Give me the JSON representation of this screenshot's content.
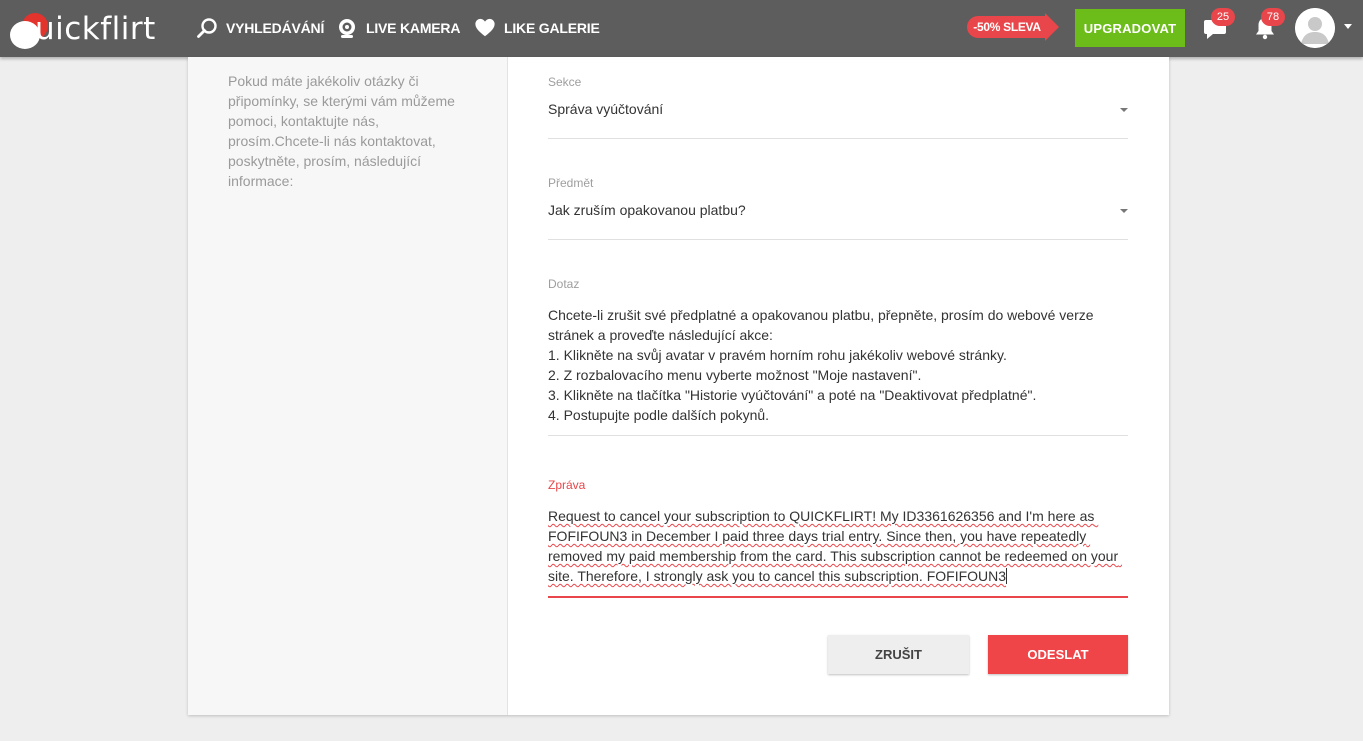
{
  "header": {
    "logo_text": "uickflirt",
    "nav": [
      {
        "label": "VYHLEDÁVÁNÍ",
        "icon": "search-icon"
      },
      {
        "label": "LIVE KAMERA",
        "icon": "webcam-icon"
      },
      {
        "label": "LIKE GALERIE",
        "icon": "heart-icon"
      }
    ],
    "sale_label": "-50% SLEVA",
    "upgrade_label": "UPGRADOVAT",
    "messages_count": "25",
    "notifications_count": "78"
  },
  "sidebar": {
    "help_text": "Pokud máte jakékoliv otázky či připomínky, se kterými vám můžeme pomoci, kontaktujte nás, prosím.Chcete-li nás kontaktovat, poskytněte, prosím, následující informace:"
  },
  "form": {
    "sekce": {
      "label": "Sekce",
      "value": "Správa vyúčtování"
    },
    "predmet": {
      "label": "Předmět",
      "value": "Jak zruším opakovanou platbu?"
    },
    "dotaz": {
      "label": "Dotaz",
      "lines": [
        "Chcete-li zrušit své předplatné a opakovanou platbu, přepněte, prosím do webové verze",
        "stránek a proveďte následující akce:",
        "1. Klikněte na svůj avatar v pravém horním rohu jakékoliv webové stránky.",
        "2. Z rozbalovacího menu vyberte možnost \"Moje nastavení\".",
        "3. Klikněte na tlačítka \"Historie vyúčtování\" a poté na \"Deaktivovat předplatné\".",
        "4. Postupujte podle dalších pokynů."
      ]
    },
    "zprava": {
      "label": "Zpráva",
      "value": "Request to cancel your subscription to QUICKFLIRT! My ID3361626356 and I'm here as FOFIFOUN3 in December I paid three days trial entry. Since then, you have repeatedly removed my paid membership from the card. This subscription cannot be redeemed on your site. Therefore, I strongly ask you to cancel this subscription. FOFIFOUN3"
    },
    "cancel_label": "ZRUŠIT",
    "send_label": "ODESLAT"
  },
  "colors": {
    "topbar": "#5d5d5d",
    "accent_red": "#e8464a",
    "upgrade_green": "#6cbd1a"
  }
}
